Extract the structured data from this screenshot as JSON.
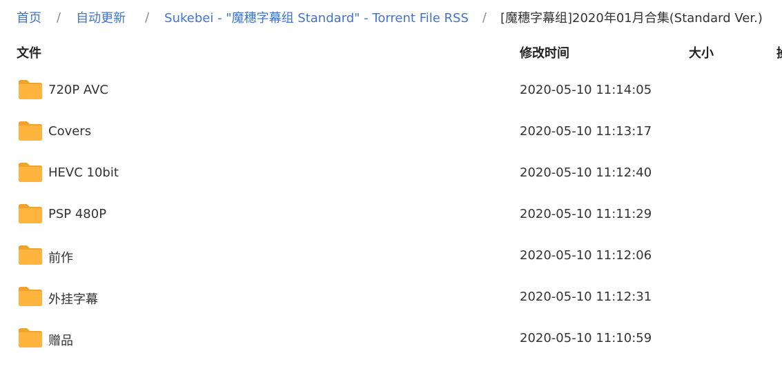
{
  "breadcrumb": {
    "items": [
      {
        "label": "首页"
      },
      {
        "label": "自动更新"
      },
      {
        "label": "Sukebei - \"魔穗字幕组 Standard\" - Torrent File RSS"
      },
      {
        "label": "[魔穗字幕组]2020年01月合集(Standard Ver.)"
      }
    ],
    "separator": "/"
  },
  "table": {
    "columns": {
      "name": "文件",
      "mtime": "修改时间",
      "size": "大小",
      "action": "操"
    },
    "rows": [
      {
        "name": "720P AVC",
        "mtime": "2020-05-10 11:14:05",
        "icon": "folder-icon"
      },
      {
        "name": "Covers",
        "mtime": "2020-05-10 11:13:17",
        "icon": "folder-icon"
      },
      {
        "name": "HEVC 10bit",
        "mtime": "2020-05-10 11:12:40",
        "icon": "folder-icon"
      },
      {
        "name": "PSP 480P",
        "mtime": "2020-05-10 11:11:29",
        "icon": "folder-icon"
      },
      {
        "name": "前作",
        "mtime": "2020-05-10 11:12:06",
        "icon": "folder-icon"
      },
      {
        "name": "外挂字幕",
        "mtime": "2020-05-10 11:12:31",
        "icon": "folder-icon"
      },
      {
        "name": "赠品",
        "mtime": "2020-05-10 11:10:59",
        "icon": "folder-icon"
      }
    ]
  },
  "colors": {
    "link": "#3f74cf",
    "text": "#333333",
    "folder": "#ffb53d",
    "folder_tab": "#f0a22e"
  }
}
